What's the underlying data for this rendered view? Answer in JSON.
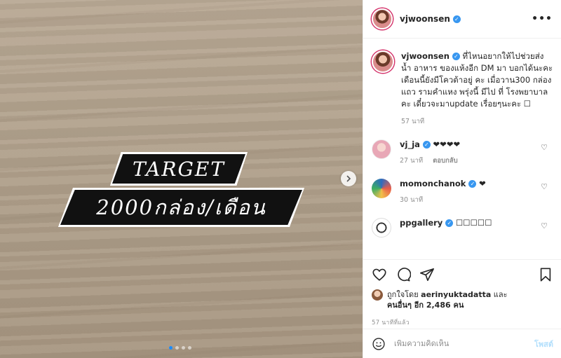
{
  "post": {
    "banner_line1": "TARGET",
    "banner_line2": "2000กล่อง/เดือน",
    "carousel_dots": 4,
    "active_dot": 0
  },
  "header": {
    "username": "vjwoonsen",
    "more_label": "•••"
  },
  "caption": {
    "username": "vjwoonsen",
    "text": "ที่ไหนอยากให้ไปช่วยส่ง น้ำ อาหาร ของแห้งอีก DM มา บอกได้นะคะ เดือนนี้ยังมีโควต้าอยู่ คะ เมื่อวาน300 กล่อง แถว รามคำแหง พรุ่งนี้ มีไป ที่ โรงพยาบาลคะ เดี๋ยวจะมาupdate เรื่อยๆนะคะ ☐",
    "time": "57 นาที"
  },
  "comments": [
    {
      "username": "vj_ja",
      "text": "❤❤❤❤",
      "time": "27 นาที",
      "reply": "ตอบกลับ"
    },
    {
      "username": "momonchanok",
      "text": "❤",
      "time": "30 นาที",
      "reply": ""
    },
    {
      "username": "ppgallery",
      "text": "☐☐☐☐☐",
      "time": "",
      "reply": ""
    }
  ],
  "likes": {
    "prefix": "ถูกใจโดย",
    "liker": "aerinyuktadatta",
    "and": "และ",
    "others": "คนอื่นๆ อีก 2,486 คน"
  },
  "post_time": "57 นาทีที่แล้ว",
  "add_comment": {
    "placeholder": "เพิ่มความคิดเห็น",
    "post_label": "โพสต์"
  },
  "colors": {
    "verified": "#3897f0",
    "story_ring": "#d4336b",
    "active_dot": "#1a8cff",
    "post_disabled": "#b2dffc"
  }
}
